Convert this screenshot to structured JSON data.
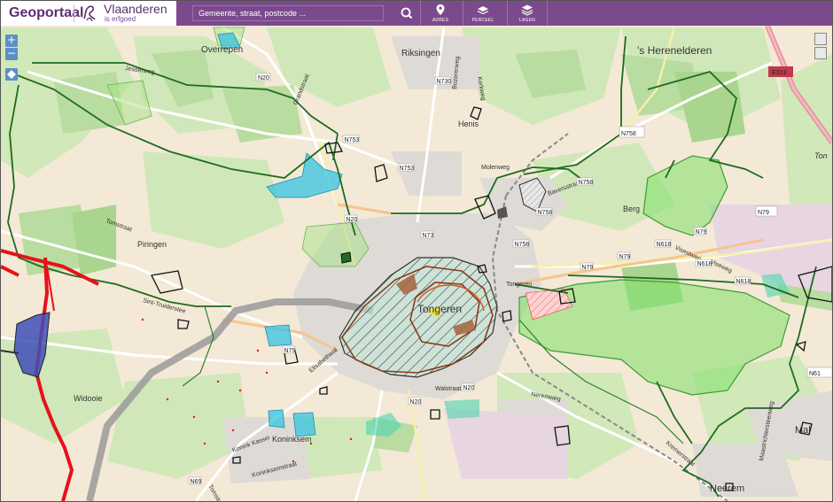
{
  "header": {
    "app_title": "Geoportaal",
    "org_name": "Vlaanderen",
    "org_sub": "is erfgoed",
    "search_placeholder": "Gemeente, straat, postcode ...",
    "nav": [
      {
        "label": "ADRES",
        "icon": "pin-icon"
      },
      {
        "label": "PERCEEL",
        "icon": "parcel-icon"
      },
      {
        "label": "LAGEN",
        "icon": "layers-icon"
      }
    ]
  },
  "controls": {
    "zoom_in": "+",
    "zoom_out": "−"
  },
  "map": {
    "places": [
      {
        "text": "Overrepen"
      },
      {
        "text": "Riksingen"
      },
      {
        "text": "'s Herenelderen"
      },
      {
        "text": "Henis"
      },
      {
        "text": "Piringen"
      },
      {
        "text": "Berg"
      },
      {
        "text": "Tongeren"
      },
      {
        "text": "Widooie"
      },
      {
        "text": "Koninksem"
      },
      {
        "text": "Neerem"
      },
      {
        "text": "Mal"
      },
      {
        "text": "Tongeren"
      },
      {
        "text": "Ton"
      }
    ],
    "roads": [
      {
        "text": "Jesserweg"
      },
      {
        "text": "Grandstraat"
      },
      {
        "text": "Bozererweg"
      },
      {
        "text": "Kerkweg"
      },
      {
        "text": "Molenweg"
      },
      {
        "text": "Baversstraat"
      },
      {
        "text": "Tomstraat"
      },
      {
        "text": "Sint-Truiderstee"
      },
      {
        "text": "Elisabethwal"
      },
      {
        "text": "Neremweg"
      },
      {
        "text": "Visestweg"
      },
      {
        "text": "Viseweg"
      },
      {
        "text": "Kremerstraat"
      },
      {
        "text": "Konink Kassei"
      },
      {
        "text": "Koninksemstraat"
      },
      {
        "text": "Tomstraat"
      },
      {
        "text": "Walstraat"
      },
      {
        "text": "Maastrichtersteenweg"
      }
    ],
    "shields": [
      {
        "text": "N20"
      },
      {
        "text": "N730"
      },
      {
        "text": "N753"
      },
      {
        "text": "N753"
      },
      {
        "text": "N758"
      },
      {
        "text": "N758"
      },
      {
        "text": "N758"
      },
      {
        "text": "E313"
      },
      {
        "text": "N79"
      },
      {
        "text": "N79"
      },
      {
        "text": "N79"
      },
      {
        "text": "N79"
      },
      {
        "text": "N618"
      },
      {
        "text": "N618"
      },
      {
        "text": "N618"
      },
      {
        "text": "N20"
      },
      {
        "text": "N20"
      },
      {
        "text": "N20"
      },
      {
        "text": "N69"
      },
      {
        "text": "N61"
      },
      {
        "text": "N73"
      },
      {
        "text": "N79"
      }
    ]
  },
  "colors": {
    "header": "#7b4a8c",
    "brand": "#5b2f73",
    "zoom": "#5c8fc7",
    "boundary_red": "#e8101a",
    "heritage_green": "#7ee06a",
    "water_cyan": "#36c3e0"
  }
}
